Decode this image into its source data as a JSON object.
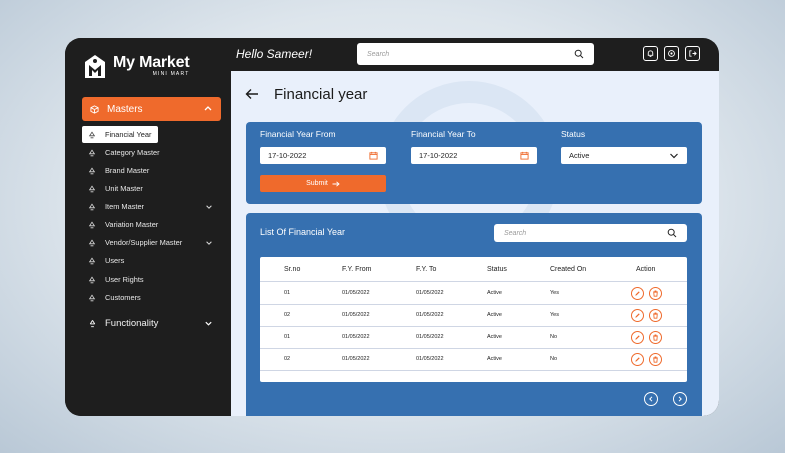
{
  "app": {
    "logo_title": "My Market",
    "logo_subtitle": "MINI MART",
    "greeting": "Hello Sameer!"
  },
  "topbar": {
    "search_placeholder": "Search",
    "icons": [
      "bell-icon",
      "settings-icon",
      "logout-icon"
    ]
  },
  "sidebar": {
    "section": "Masters",
    "items": [
      {
        "label": "Financial Year",
        "active": true,
        "has_submenu": false
      },
      {
        "label": "Category Master",
        "has_submenu": false
      },
      {
        "label": "Brand Master",
        "has_submenu": false
      },
      {
        "label": "Unit Master",
        "has_submenu": false
      },
      {
        "label": "Item Master",
        "has_submenu": true
      },
      {
        "label": "Variation Master",
        "has_submenu": false
      },
      {
        "label": "Vendor/Supplier Master",
        "has_submenu": true
      },
      {
        "label": "Users",
        "has_submenu": false
      },
      {
        "label": "User Rights",
        "has_submenu": false
      },
      {
        "label": "Customers",
        "has_submenu": false
      }
    ],
    "functionality": "Functionality"
  },
  "page": {
    "title": "Financial year"
  },
  "form": {
    "from_label": "Financial Year From",
    "from_value": "17-10-2022",
    "to_label": "Financial Year To",
    "to_value": "17-10-2022",
    "status_label": "Status",
    "status_value": "Active",
    "submit_label": "Submit"
  },
  "list": {
    "title": "List Of Financial Year",
    "search_placeholder": "Search",
    "columns": [
      "Sr.no",
      "F.Y. From",
      "F.Y. To",
      "Status",
      "Created On",
      "Action"
    ],
    "rows": [
      {
        "srno": "01",
        "from": "01/05/2022",
        "to": "01/05/2022",
        "status": "Active",
        "created": "Yes"
      },
      {
        "srno": "02",
        "from": "01/05/2022",
        "to": "01/05/2022",
        "status": "Active",
        "created": "Yes"
      },
      {
        "srno": "01",
        "from": "01/05/2022",
        "to": "01/05/2022",
        "status": "Active",
        "created": "No"
      },
      {
        "srno": "02",
        "from": "01/05/2022",
        "to": "01/05/2022",
        "status": "Active",
        "created": "No"
      }
    ]
  },
  "colors": {
    "accent": "#ef6a2c",
    "panel": "#3670b0",
    "sidebar": "#1e1e1e",
    "main_bg": "#e9f0fb"
  }
}
